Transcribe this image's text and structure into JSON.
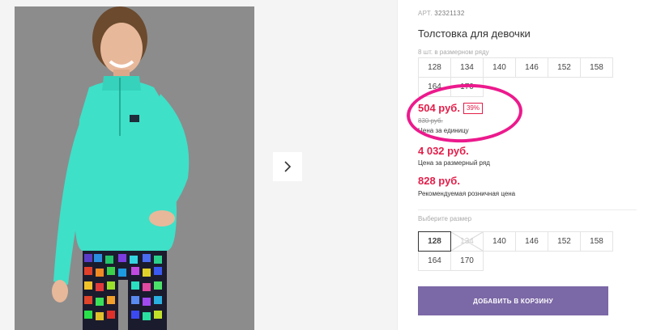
{
  "gallery": {
    "photo_alt": "",
    "next_icon": "chevron-right-icon"
  },
  "product": {
    "article_label": "АРТ.",
    "article_number": "32321132",
    "title": "Толстовка для девочки",
    "row_note": "8 шт. в размерном ряду",
    "row_sizes": [
      "128",
      "134",
      "140",
      "146",
      "152",
      "158",
      "164",
      "170"
    ],
    "price": "504 руб.",
    "discount": "39%",
    "old_price": "830 руб.",
    "price_label": "Цена за единицу",
    "set_price": "4 032 руб.",
    "set_price_label": "Цена за размерный ряд",
    "rrp_price": "828 руб.",
    "rrp_label": "Рекомендуемая розничная цена",
    "choose_size_label": "Выберите размер",
    "choose_sizes": [
      {
        "label": "128",
        "state": "selected"
      },
      {
        "label": "134",
        "state": "disabled"
      },
      {
        "label": "140",
        "state": "available"
      },
      {
        "label": "146",
        "state": "available"
      },
      {
        "label": "152",
        "state": "available"
      },
      {
        "label": "158",
        "state": "available"
      },
      {
        "label": "164",
        "state": "available"
      },
      {
        "label": "170",
        "state": "available"
      }
    ],
    "add_to_cart": "ДОБАВИТЬ В КОРЗИНУ"
  },
  "colors": {
    "accent_red": "#e31e4a",
    "button_purple": "#7b68a6",
    "highlight_pink": "#ec1a8d",
    "fleece_turquoise": "#3ee0c8"
  }
}
